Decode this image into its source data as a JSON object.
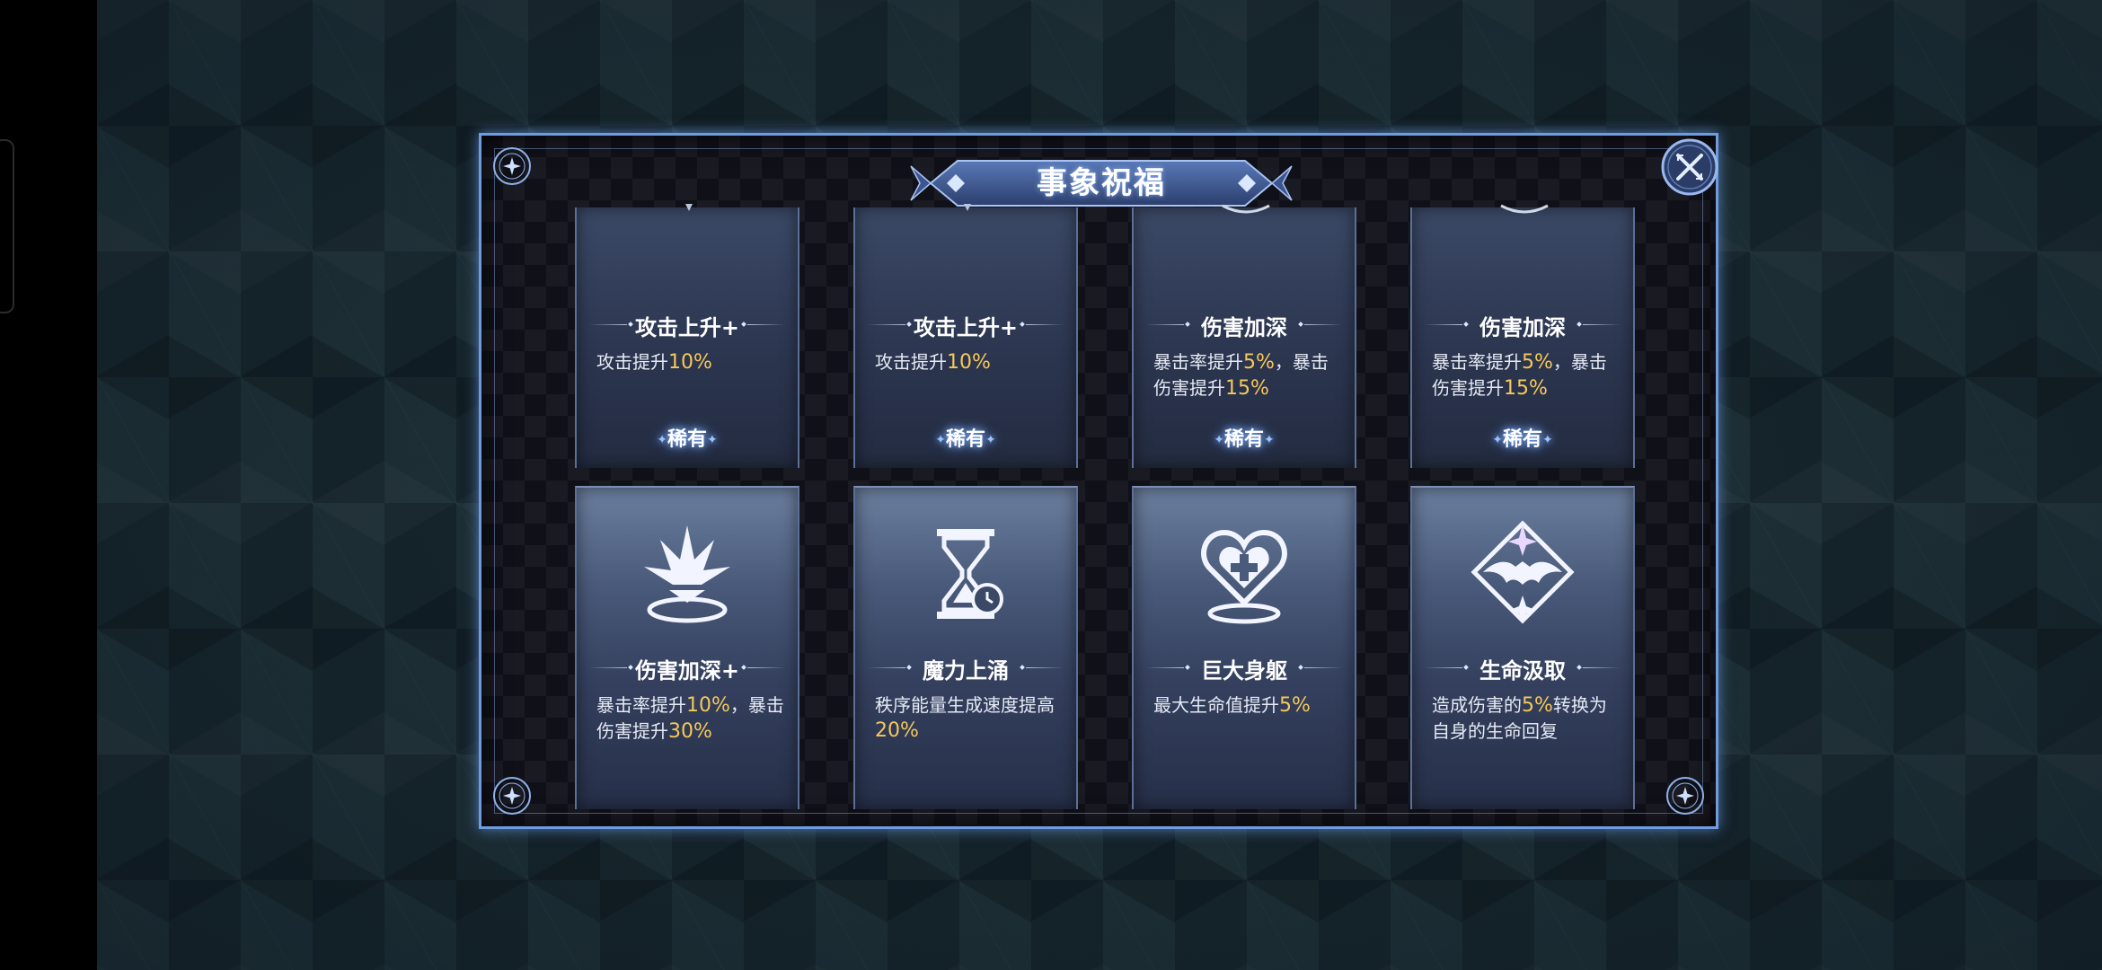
{
  "dialog": {
    "title": "事象祝福"
  },
  "colors": {
    "highlight": "#f6c85a",
    "frame": "#6f9be0",
    "card_text": "#e6eaf5"
  },
  "cards_top": [
    {
      "name": "攻击上升+",
      "desc_prefix": "攻击提升",
      "desc_hl1": "10%",
      "desc_mid": "",
      "desc_hl2": "",
      "rarity": "稀有",
      "icon": "sword-icon"
    },
    {
      "name": "攻击上升+",
      "desc_prefix": "攻击提升",
      "desc_hl1": "10%",
      "desc_mid": "",
      "desc_hl2": "",
      "rarity": "稀有",
      "icon": "sword-icon"
    },
    {
      "name": "伤害加深",
      "desc_prefix": "暴击率提升",
      "desc_hl1": "5%",
      "desc_mid": "，暴击伤害提升",
      "desc_hl2": "15%",
      "rarity": "稀有",
      "icon": "ring-icon"
    },
    {
      "name": "伤害加深",
      "desc_prefix": "暴击率提升",
      "desc_hl1": "5%",
      "desc_mid": "，暴击伤害提升",
      "desc_hl2": "15%",
      "rarity": "稀有",
      "icon": "ring-icon"
    }
  ],
  "cards_bottom": [
    {
      "name": "伤害加深+",
      "desc_prefix": "暴击率提升",
      "desc_hl1": "10%",
      "desc_mid": "，暴击伤害提升",
      "desc_hl2": "30%",
      "desc_suffix": "",
      "icon": "burst-icon"
    },
    {
      "name": "魔力上涌",
      "desc_prefix": "秩序能量生成速度提高",
      "desc_hl1": "20%",
      "desc_mid": "",
      "desc_hl2": "",
      "desc_suffix": "",
      "icon": "hourglass-icon"
    },
    {
      "name": "巨大身躯",
      "desc_prefix": "最大生命值提升",
      "desc_hl1": "5%",
      "desc_mid": "",
      "desc_hl2": "",
      "desc_suffix": "",
      "icon": "heart-plus-icon"
    },
    {
      "name": "生命汲取",
      "desc_prefix": "造成伤害的",
      "desc_hl1": "5%",
      "desc_mid": "",
      "desc_hl2": "",
      "desc_suffix": "转换为自身的生命回复",
      "icon": "bat-diamond-icon"
    }
  ]
}
